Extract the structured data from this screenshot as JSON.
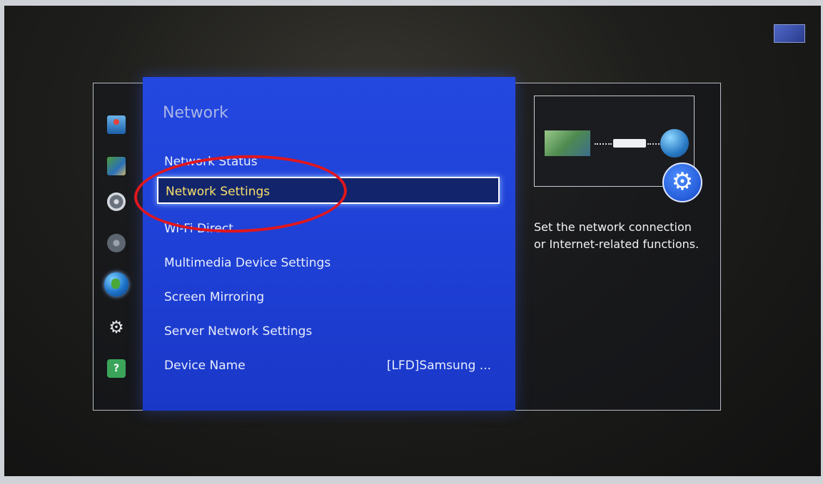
{
  "panel": {
    "title": "Network"
  },
  "menu": {
    "items": [
      {
        "label": "Network Status",
        "value": ""
      },
      {
        "label": "Network Settings",
        "value": ""
      },
      {
        "label": "Wi-Fi Direct",
        "value": ""
      },
      {
        "label": "Multimedia Device Settings",
        "value": ""
      },
      {
        "label": "Screen Mirroring",
        "value": ""
      },
      {
        "label": "Server Network Settings",
        "value": ""
      },
      {
        "label": "Device Name",
        "value": "[LFD]Samsung ..."
      }
    ],
    "selected_index": 1
  },
  "side_icons": [
    "picture-icon",
    "sound-icon",
    "broadcast-icon",
    "speaker-icon",
    "network-globe-icon",
    "system-gear-icon",
    "support-question-icon"
  ],
  "help": {
    "description": "Set the network connection or Internet-related functions."
  },
  "colors": {
    "panel_blue": "#1e3fd4",
    "selected_text": "#f6e06a",
    "highlight_red": "#e2161c"
  }
}
